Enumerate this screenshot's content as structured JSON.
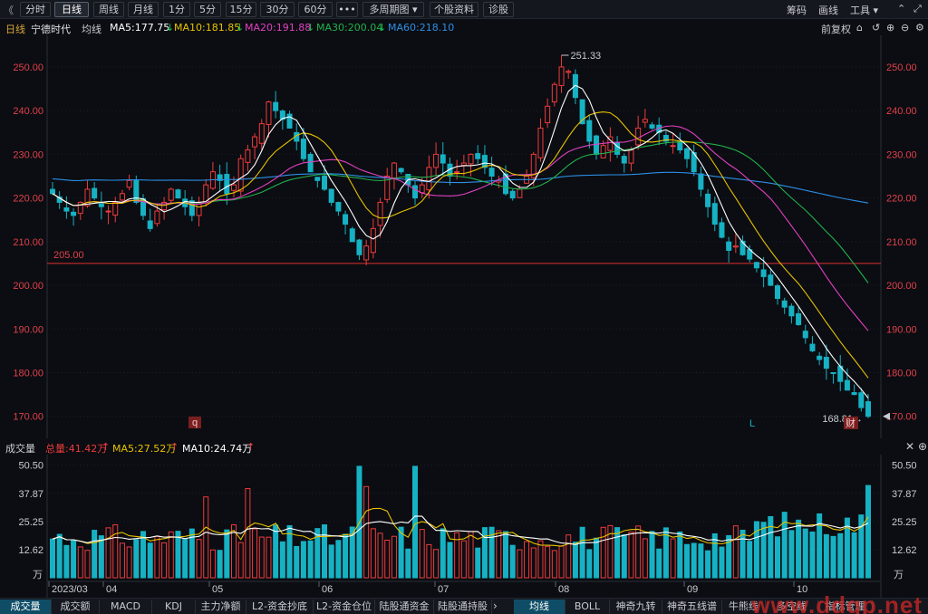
{
  "toolbar": {
    "collapse": "《",
    "buttons": [
      "分时",
      "日线",
      "周线",
      "月线",
      "1分",
      "5分",
      "15分",
      "30分",
      "60分",
      "•••",
      "多周期图 ▾",
      "个股资料",
      "诊股"
    ],
    "active_index": 1,
    "right": [
      "筹码",
      "画线",
      "工具 ▾"
    ],
    "icons": [
      "drag-icon",
      "fullscreen-icon"
    ]
  },
  "info": {
    "period": "日线",
    "stock_name": "宁德时代",
    "avg_label": "均线",
    "ma5": "MA5:177.75",
    "ma10": "MA10:181.85",
    "ma20": "MA20:191.88",
    "ma30": "MA30:200.04",
    "ma60": "MA60:218.10",
    "adjust": "前复权",
    "icons": [
      "lock-icon",
      "undo-icon",
      "zoom-in-icon",
      "zoom-out-icon",
      "gear-icon"
    ]
  },
  "colors": {
    "up": "#ee3b3b",
    "down": "#16b2c4",
    "ma5": "#ffffff",
    "ma10": "#e8c200",
    "ma20": "#e040c0",
    "ma30": "#22b14c",
    "ma60": "#2d8fe6",
    "axis_text": "#e0404a",
    "support": "#e03030"
  },
  "price_axis": {
    "ticks": [
      "250.00",
      "240.00",
      "230.00",
      "220.00",
      "210.00",
      "200.00",
      "190.00",
      "180.00",
      "170.00"
    ]
  },
  "annotations": {
    "high": "251.33",
    "low": "168.81",
    "support": "205.00",
    "marker_q": "q",
    "marker_l": "L",
    "marker_cai": "财"
  },
  "volume": {
    "title": "成交量",
    "total": "总量:41.42万",
    "ma5": "MA5:27.52万",
    "ma10": "MA10:24.74万",
    "ticks": [
      "50.50",
      "37.87",
      "25.25",
      "12.62"
    ],
    "unit": "万"
  },
  "date_axis": [
    "2023/03",
    "04",
    "05",
    "06",
    "07",
    "08",
    "09",
    "10"
  ],
  "bottom_tabs_left": [
    "成交量",
    "成交额",
    "MACD",
    "KDJ",
    "主力净额",
    "L2-资金抄底",
    "L2-资金仓位",
    "陆股通资金",
    "陆股通持股"
  ],
  "bottom_tabs_right": [
    "均线",
    "BOLL",
    "神奇九转",
    "神奇五线谱",
    "牛熊线",
    "多空线",
    "指标管理"
  ],
  "watermark": "www.ddgp.net",
  "chart_data": {
    "type": "candlestick",
    "symbol": "宁德时代",
    "period": "日线",
    "x_range": [
      "2023/03",
      "10"
    ],
    "ylim": [
      166,
      256
    ],
    "price_close_path": [
      221,
      219,
      217,
      216,
      219,
      222,
      220,
      218,
      217,
      219,
      221,
      224,
      219,
      216,
      213,
      217,
      219,
      222,
      220,
      218,
      216,
      219,
      223,
      226,
      224,
      221,
      223,
      229,
      231,
      234,
      237,
      242,
      240,
      238,
      236,
      233,
      229,
      226,
      224,
      222,
      219,
      217,
      214,
      210,
      207,
      209,
      213,
      219,
      225,
      228,
      226,
      223,
      220,
      223,
      227,
      230,
      228,
      225,
      226,
      228,
      230,
      229,
      227,
      225,
      224,
      221,
      220,
      222,
      225,
      230,
      236,
      241,
      246,
      250,
      249,
      243,
      237,
      233,
      230,
      232,
      234,
      230,
      228,
      231,
      236,
      238,
      236,
      235,
      233,
      232,
      231,
      229,
      226,
      222,
      218,
      214,
      211,
      208,
      209,
      207,
      206,
      204,
      202,
      200,
      197,
      195,
      193,
      191,
      188,
      185,
      183,
      181,
      180,
      178,
      176,
      175,
      172,
      170
    ],
    "volume_range": [
      0,
      52
    ]
  }
}
